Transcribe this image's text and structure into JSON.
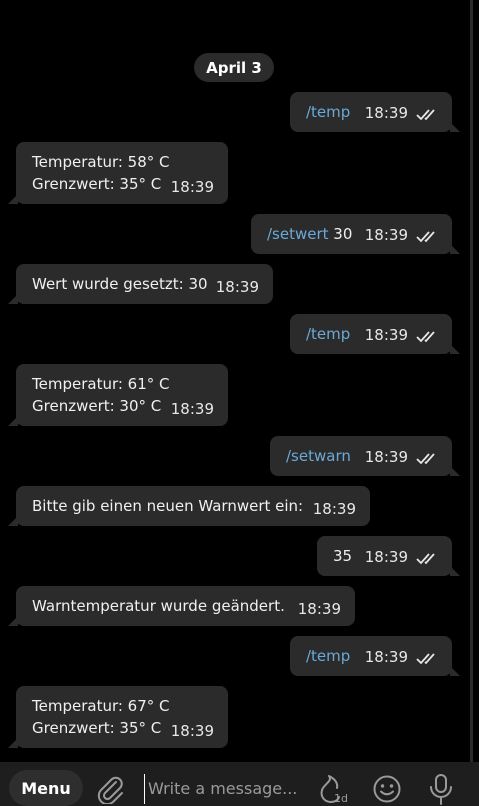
{
  "date_separator": "April 3",
  "messages": [
    {
      "dir": "out",
      "type": "cmd",
      "parts": [
        {
          "cmd": "/temp",
          "rest": ""
        }
      ],
      "time": "18:39",
      "status": "read"
    },
    {
      "dir": "in",
      "lines": [
        "Temperatur: 58° C",
        "Grenzwert: 35° C"
      ],
      "time": "18:39"
    },
    {
      "dir": "out",
      "type": "cmd",
      "parts": [
        {
          "cmd": "/setwert",
          "rest": " 30"
        }
      ],
      "time": "18:39",
      "status": "read"
    },
    {
      "dir": "in",
      "lines": [
        "Wert wurde gesetzt: 30"
      ],
      "time": "18:39"
    },
    {
      "dir": "out",
      "type": "cmd",
      "parts": [
        {
          "cmd": "/temp",
          "rest": ""
        }
      ],
      "time": "18:39",
      "status": "read"
    },
    {
      "dir": "in",
      "lines": [
        "Temperatur: 61° C",
        "Grenzwert: 30° C"
      ],
      "time": "18:39"
    },
    {
      "dir": "out",
      "type": "cmd",
      "parts": [
        {
          "cmd": "/setwarn",
          "rest": ""
        }
      ],
      "time": "18:39",
      "status": "read"
    },
    {
      "dir": "in",
      "lines": [
        "Bitte gib einen neuen Warnwert ein:"
      ],
      "time": "18:39"
    },
    {
      "dir": "out",
      "type": "text",
      "parts": [
        {
          "cmd": "",
          "rest": "35"
        }
      ],
      "time": "18:39",
      "status": "read"
    },
    {
      "dir": "in",
      "lines": [
        "Warntemperatur wurde geändert."
      ],
      "time": "18:39"
    },
    {
      "dir": "out",
      "type": "cmd",
      "parts": [
        {
          "cmd": "/temp",
          "rest": ""
        }
      ],
      "time": "18:39",
      "status": "read"
    },
    {
      "dir": "in",
      "lines": [
        "Temperatur: 67° C",
        "Grenzwert: 35° C"
      ],
      "time": "18:39"
    }
  ],
  "composer": {
    "menu_label": "Menu",
    "placeholder": "Write a message...",
    "timer_label": "1d",
    "attach_icon": "paperclip-icon",
    "timer_icon": "flame-timer-icon",
    "emoji_icon": "emoji-icon",
    "mic_icon": "microphone-icon"
  },
  "colors": {
    "background": "#000000",
    "bubble": "#2b2b2b",
    "command_link": "#6aa9d8",
    "composer": "#1e1e1e"
  }
}
